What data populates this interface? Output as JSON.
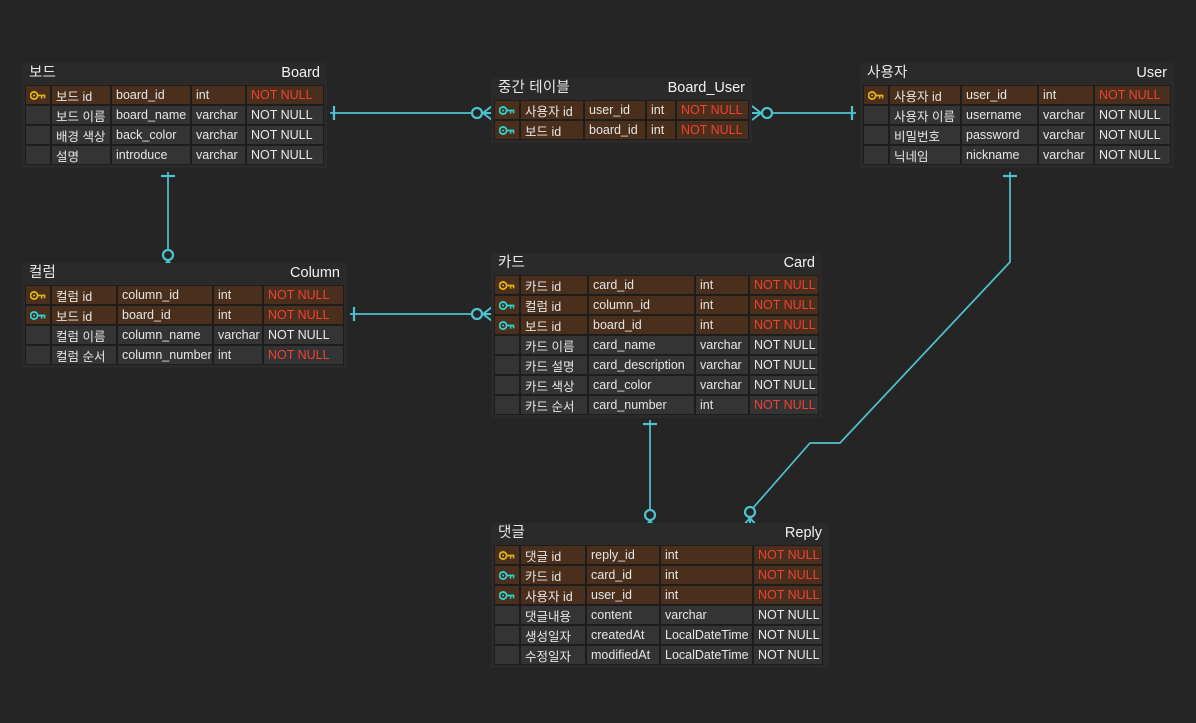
{
  "canvas": {
    "background": "#252526",
    "link_color": "#4ec3d0"
  },
  "legend": {
    "pk_icon": "gold-key-icon",
    "fk_icon": "teal-key-icon",
    "pk_color": "#e3b417",
    "fk_color": "#2fd3d3",
    "not_null_required_color": "#ef4136",
    "not_null_color": "#eaeaea",
    "key_row_background": "#4a2f1c",
    "cell_background": "#343434"
  },
  "entities": {
    "board": {
      "name_ko": "보드",
      "name_en": "Board",
      "columns": [
        {
          "key": "pk",
          "ko": "보드 id",
          "en": "board_id",
          "type": "int",
          "null": "NOT NULL",
          "required": true
        },
        {
          "key": "",
          "ko": "보드 이름",
          "en": "board_name",
          "type": "varchar",
          "null": "NOT NULL",
          "required": false
        },
        {
          "key": "",
          "ko": "배경 색상",
          "en": "back_color",
          "type": "varchar",
          "null": "NOT NULL",
          "required": false
        },
        {
          "key": "",
          "ko": "설명",
          "en": "introduce",
          "type": "varchar",
          "null": "NOT NULL",
          "required": false
        }
      ]
    },
    "board_user": {
      "name_ko": "중간 테이블",
      "name_en": "Board_User",
      "columns": [
        {
          "key": "fk",
          "ko": "사용자 id",
          "en": "user_id",
          "type": "int",
          "null": "NOT NULL",
          "required": true
        },
        {
          "key": "fk",
          "ko": "보드 id",
          "en": "board_id",
          "type": "int",
          "null": "NOT NULL",
          "required": true
        }
      ]
    },
    "user": {
      "name_ko": "사용자",
      "name_en": "User",
      "columns": [
        {
          "key": "pk",
          "ko": "사용자 id",
          "en": "user_id",
          "type": "int",
          "null": "NOT NULL",
          "required": true
        },
        {
          "key": "",
          "ko": "사용자 이름",
          "en": "username",
          "type": "varchar",
          "null": "NOT NULL",
          "required": false
        },
        {
          "key": "",
          "ko": "비밀번호",
          "en": "password",
          "type": "varchar",
          "null": "NOT NULL",
          "required": false
        },
        {
          "key": "",
          "ko": "닉네임",
          "en": "nickname",
          "type": "varchar",
          "null": "NOT NULL",
          "required": false
        }
      ]
    },
    "column": {
      "name_ko": "컬럼",
      "name_en": "Column",
      "columns": [
        {
          "key": "pk",
          "ko": "컬럼 id",
          "en": "column_id",
          "type": "int",
          "null": "NOT NULL",
          "required": true
        },
        {
          "key": "fk",
          "ko": "보드 id",
          "en": "board_id",
          "type": "int",
          "null": "NOT NULL",
          "required": true
        },
        {
          "key": "",
          "ko": "컬럼 이름",
          "en": "column_name",
          "type": "varchar",
          "null": "NOT NULL",
          "required": false
        },
        {
          "key": "",
          "ko": "컬럼 순서",
          "en": "column_number",
          "type": "int",
          "null": "NOT NULL",
          "required": true
        }
      ]
    },
    "card": {
      "name_ko": "카드",
      "name_en": "Card",
      "columns": [
        {
          "key": "pk",
          "ko": "카드 id",
          "en": "card_id",
          "type": "int",
          "null": "NOT NULL",
          "required": true
        },
        {
          "key": "fk",
          "ko": "컬럼 id",
          "en": "column_id",
          "type": "int",
          "null": "NOT NULL",
          "required": true
        },
        {
          "key": "fk",
          "ko": "보드 id",
          "en": "board_id",
          "type": "int",
          "null": "NOT NULL",
          "required": true
        },
        {
          "key": "",
          "ko": "카드 이름",
          "en": "card_name",
          "type": "varchar",
          "null": "NOT NULL",
          "required": false
        },
        {
          "key": "",
          "ko": "카드 설명",
          "en": "card_description",
          "type": "varchar",
          "null": "NOT NULL",
          "required": false
        },
        {
          "key": "",
          "ko": "카드 색상",
          "en": "card_color",
          "type": "varchar",
          "null": "NOT NULL",
          "required": false
        },
        {
          "key": "",
          "ko": "카드 순서",
          "en": "card_number",
          "type": "int",
          "null": "NOT NULL",
          "required": true
        }
      ]
    },
    "reply": {
      "name_ko": "댓글",
      "name_en": "Reply",
      "columns": [
        {
          "key": "pk",
          "ko": "댓글 id",
          "en": "reply_id",
          "type": "int",
          "null": "NOT NULL",
          "required": true
        },
        {
          "key": "fk",
          "ko": "카드 id",
          "en": "card_id",
          "type": "int",
          "null": "NOT NULL",
          "required": true
        },
        {
          "key": "fk",
          "ko": "사용자 id",
          "en": "user_id",
          "type": "int",
          "null": "NOT NULL",
          "required": true
        },
        {
          "key": "",
          "ko": "댓글내용",
          "en": "content",
          "type": "varchar",
          "null": "NOT NULL",
          "required": false
        },
        {
          "key": "",
          "ko": "생성일자",
          "en": "createdAt",
          "type": "LocalDateTime",
          "null": "NOT NULL",
          "required": false
        },
        {
          "key": "",
          "ko": "수정일자",
          "en": "modifiedAt",
          "type": "LocalDateTime",
          "null": "NOT NULL",
          "required": false
        }
      ]
    }
  },
  "relationships": [
    {
      "id": "board-boarduser",
      "from": "board",
      "to": "board_user",
      "from_card": "one",
      "to_card": "many"
    },
    {
      "id": "user-boarduser",
      "from": "user",
      "to": "board_user",
      "from_card": "one",
      "to_card": "many"
    },
    {
      "id": "board-column",
      "from": "board",
      "to": "column",
      "from_card": "one",
      "to_card": "many"
    },
    {
      "id": "column-card",
      "from": "column",
      "to": "card",
      "from_card": "one",
      "to_card": "many"
    },
    {
      "id": "card-reply",
      "from": "card",
      "to": "reply",
      "from_card": "one",
      "to_card": "many"
    },
    {
      "id": "user-reply",
      "from": "user",
      "to": "reply",
      "from_card": "one",
      "to_card": "many"
    }
  ]
}
